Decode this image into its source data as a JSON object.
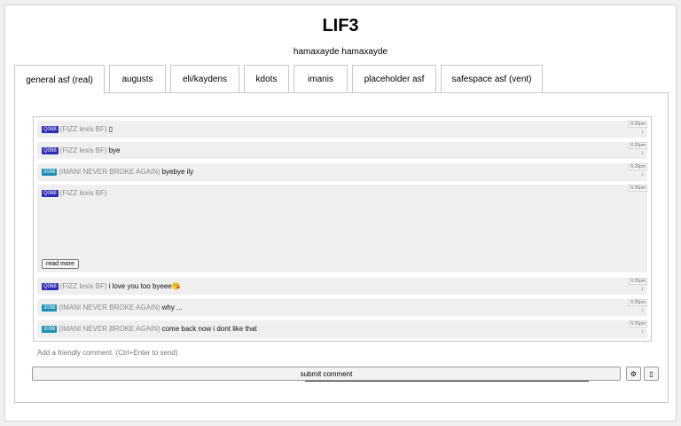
{
  "header": {
    "title": "LIF3",
    "subtitle": "hamaxayde hamaxayde"
  },
  "tabs": [
    {
      "label": "general asf (real)"
    },
    {
      "label": "augusts"
    },
    {
      "label": "eli/kaydens"
    },
    {
      "label": "kdots"
    },
    {
      "label": "imanis"
    },
    {
      "label": "placeholder asf"
    },
    {
      "label": "safespace asf (vent)"
    }
  ],
  "messages": [
    {
      "badge": "Q088",
      "name": "(FIZZ lexis BF)",
      "text": "▯",
      "time": "6:25pm",
      "arrow": "↕"
    },
    {
      "badge": "Q088",
      "name": "(FIZZ lexis BF)",
      "text": "bye",
      "time": "6:26pm",
      "arrow": "↕"
    },
    {
      "badge": "3098",
      "name": "(IMANI NEVER BROKE AGAIN)",
      "text": "byebye ily",
      "time": "6:26pm",
      "arrow": "↓"
    },
    {
      "badge": "Q088",
      "name": "(FIZZ lexis BF)",
      "text": "",
      "time": "6:26pm",
      "arrow": "↕",
      "read_more": "read more"
    },
    {
      "badge": "Q088",
      "name": "(FIZZ lexis BF)",
      "text": "i love you too byeee😘",
      "time": "6:26pm",
      "arrow": "↕"
    },
    {
      "badge": "3098",
      "name": "(IMANI NEVER BROKE AGAIN)",
      "text": "why ...",
      "time": "6:26pm",
      "arrow": "↓"
    },
    {
      "badge": "3098",
      "name": "(IMANI NEVER BROKE AGAIN)",
      "text": "come  back now i dont like that",
      "time": "6:26pm",
      "arrow": "↕"
    }
  ],
  "comment": {
    "placeholder": "Add a friendly comment. (Ctrl+Enter to send)"
  },
  "submit": {
    "label": "submit comment",
    "settings_icon": "⚙",
    "extra_icon": "▯"
  },
  "colors": {
    "badge_blue": "#2c2cb4",
    "badge_teal": "#1b8fb3",
    "message_bg": "#efefef"
  }
}
